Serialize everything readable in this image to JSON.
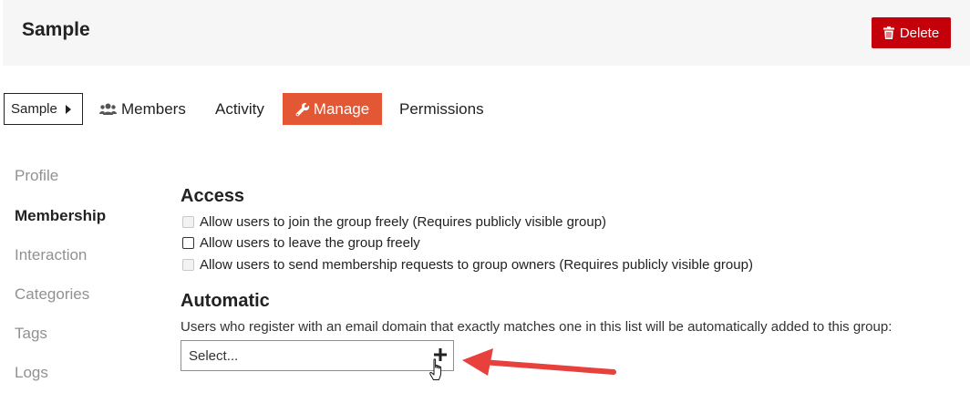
{
  "header": {
    "title": "Sample",
    "delete_label": "Delete"
  },
  "nav": {
    "breadcrumb": "Sample",
    "tabs": [
      {
        "label": "Members",
        "icon": "users-icon"
      },
      {
        "label": "Activity"
      },
      {
        "label": "Manage",
        "icon": "wrench-icon",
        "active": true
      },
      {
        "label": "Permissions"
      }
    ]
  },
  "sidebar": {
    "items": [
      {
        "label": "Profile"
      },
      {
        "label": "Membership",
        "active": true
      },
      {
        "label": "Interaction"
      },
      {
        "label": "Categories"
      },
      {
        "label": "Tags"
      },
      {
        "label": "Logs"
      }
    ]
  },
  "access": {
    "heading": "Access",
    "options": [
      {
        "label": "Allow users to join the group freely (Requires publicly visible group)",
        "checked": false,
        "disabled": true
      },
      {
        "label": "Allow users to leave the group freely",
        "checked": false,
        "disabled": false
      },
      {
        "label": "Allow users to send membership requests to group owners (Requires publicly visible group)",
        "checked": false,
        "disabled": true
      }
    ]
  },
  "automatic": {
    "heading": "Automatic",
    "description": "Users who register with an email domain that exactly matches one in this list will be automatically added to this group:",
    "select_placeholder": "Select..."
  },
  "colors": {
    "delete_button": "#c4000a",
    "manage_tab": "#e45735",
    "annotation_arrow": "#e8403c",
    "header_bg": "#f6f6f6"
  }
}
